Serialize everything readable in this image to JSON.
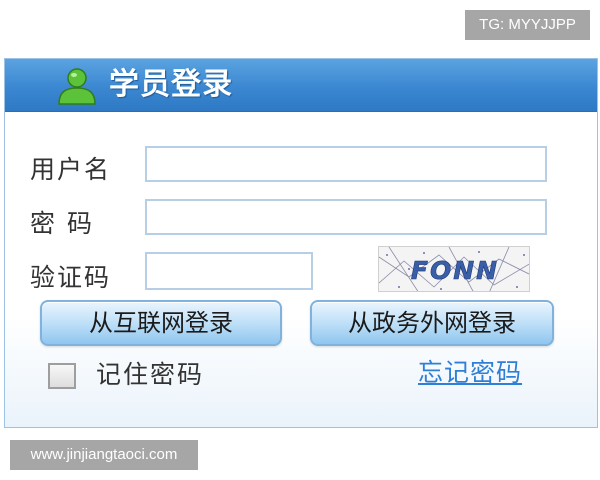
{
  "tg_badge": "TG: MYYJJPP",
  "watermark": "www.jinjiangtaoci.com",
  "login_panel": {
    "title": "学员登录",
    "title_icon": "user-icon",
    "username_label": "用户名",
    "password_label": "密 码",
    "captcha_label": "验证码",
    "username_value": "",
    "password_value": "",
    "captcha_value": "",
    "captcha_image_text": "FONN",
    "internet_login_button": "从互联网登录",
    "extranet_login_button": "从政务外网登录",
    "remember_password_label": "记住密码",
    "remember_password_checked": false,
    "forgot_password_link": "忘记密码"
  },
  "colors": {
    "header_blue": "#3b87d1",
    "link_blue": "#2f7fd6",
    "icon_green": "#4caf30",
    "button_blue": "#bfe0f8"
  }
}
